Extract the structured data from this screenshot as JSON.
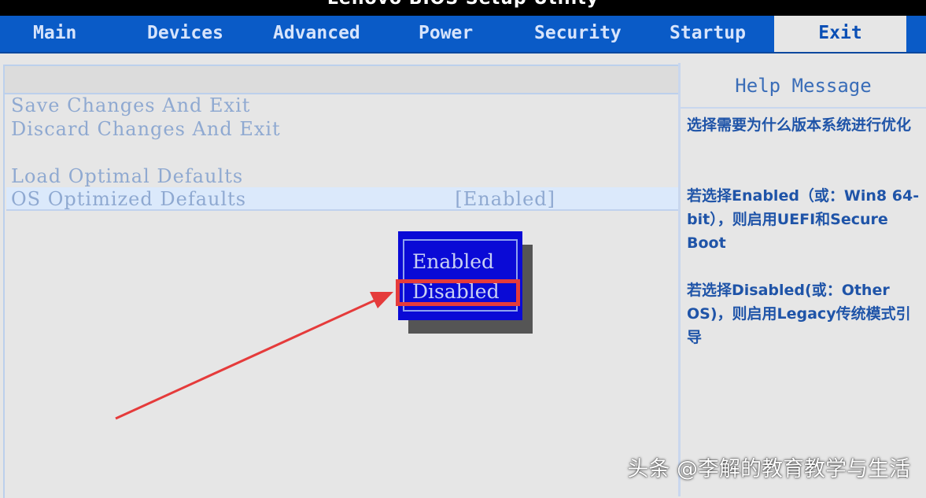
{
  "app": {
    "title": "Lenovo BIOS Setup Utility"
  },
  "tabs": [
    {
      "label": "Main"
    },
    {
      "label": "Devices"
    },
    {
      "label": "Advanced"
    },
    {
      "label": "Power"
    },
    {
      "label": "Security"
    },
    {
      "label": "Startup"
    },
    {
      "label": "Exit"
    }
  ],
  "active_tab": "Exit",
  "menu": [
    {
      "label": "Save Changes And Exit"
    },
    {
      "label": "Discard Changes And Exit"
    },
    {
      "label": "Load Optimal Defaults"
    },
    {
      "label": "OS Optimized Defaults",
      "value": "[Enabled]"
    }
  ],
  "popup": {
    "options": [
      "Enabled",
      "Disabled"
    ],
    "highlighted": "Disabled"
  },
  "help": {
    "title": "Help Message",
    "paragraphs": [
      "选择需要为什么版本系统进行优化",
      "若选择Enabled（或：Win8 64-bit），则启用UEFI和Secure Boot",
      "若选择Disabled(或：Other OS)，则启用Legacy传统模式引导"
    ]
  },
  "watermark": "头条 @李解的教育教学与生活",
  "colors": {
    "tab_bar": "#0a5bc7",
    "popup_bg": "#0a0ad6",
    "annotation_red": "#e53b3b",
    "menu_text": "#8fa9d1",
    "help_text": "#1f54a8"
  }
}
